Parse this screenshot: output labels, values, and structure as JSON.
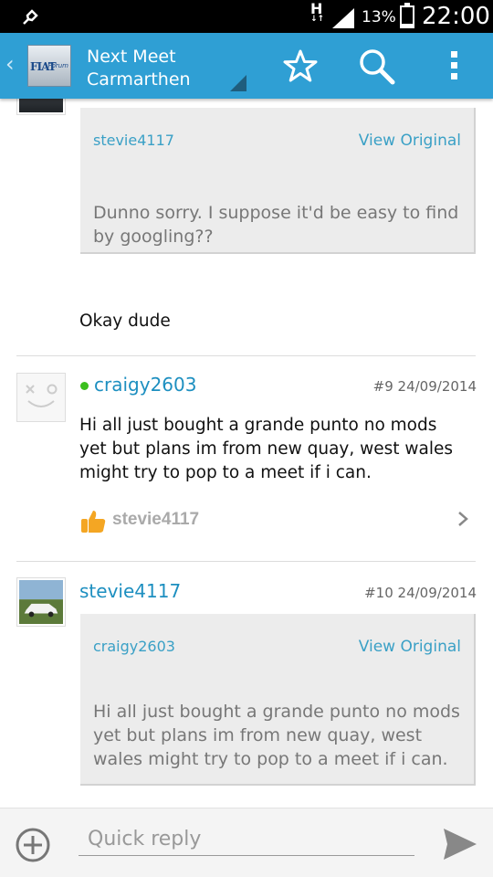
{
  "status_bar": {
    "network": "H",
    "battery": "13%",
    "time": "22:00"
  },
  "action_bar": {
    "title_line1": "Next Meet",
    "title_line2": "Carmarthen",
    "logo_text": "FIAT",
    "logo_sub": "Forum",
    "accent_color": "#2f9fd4"
  },
  "posts": [
    {
      "quote": {
        "user": "stevie4117",
        "view_label": "View Original",
        "text": "Dunno sorry. I suppose it'd be easy to find by googling??"
      },
      "message": "Okay dude"
    },
    {
      "username": "craigy2603",
      "online": true,
      "post_number": "#9",
      "date": "24/09/2014",
      "message": "Hi all just bought a grande punto no mods yet but plans im from new quay, west wales might try to pop to a meet if i can.",
      "likes": {
        "user": "stevie4117"
      }
    },
    {
      "username": "stevie4117",
      "post_number": "#10",
      "date": "24/09/2014",
      "quote": {
        "user": "craigy2603",
        "view_label": "View Original",
        "text": "Hi all just bought a grande punto no mods yet but plans im from new quay, west wales might try to pop to a meet if i can."
      }
    }
  ],
  "reply": {
    "placeholder": "Quick reply"
  }
}
